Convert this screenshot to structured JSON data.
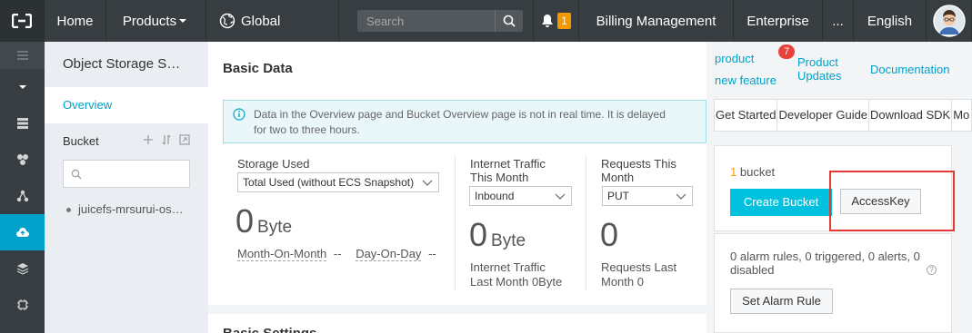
{
  "topbar": {
    "home": "Home",
    "products": "Products",
    "global": "Global",
    "search_placeholder": "Search",
    "notification_count": "1",
    "billing": "Billing Management",
    "enterprise": "Enterprise",
    "more": "...",
    "language": "English"
  },
  "sidebar": {
    "title": "Object Storage S…",
    "overview": "Overview",
    "bucket_heading": "Bucket",
    "bucket_item": "juicefs-mrsurui-os…"
  },
  "basic_data": {
    "title": "Basic Data",
    "notice_line1": "Data in the Overview page and Bucket Overview page is not in real time. It is delayed",
    "notice_line2": "for two to three hours.",
    "storage": {
      "label": "Storage Used",
      "select_value": "Total Used (without ECS Snapshot)",
      "value": "0",
      "unit": "Byte",
      "mom_label": "Month-On-Month",
      "mom_value": "--",
      "dod_label": "Day-On-Day",
      "dod_value": "--"
    },
    "traffic": {
      "label_line1": "Internet Traffic",
      "label_line2": "This Month",
      "select_value": "Inbound",
      "value": "0",
      "unit": "Byte",
      "last_line1": "Internet Traffic",
      "last_line2": "Last Month",
      "last_value": "0Byte"
    },
    "requests": {
      "label_line1": "Requests This",
      "label_line2": "Month",
      "select_value": "PUT",
      "value": "0",
      "last_line1": "Requests Last",
      "last_line2": "Month",
      "last_value": "0"
    }
  },
  "basic_settings": {
    "title": "Basic Settings"
  },
  "right": {
    "product_line1": "product",
    "product_line2": "new feature",
    "updates_badge": "7",
    "updates_line1": "Product",
    "updates_line2": "Updates",
    "documentation": "Documentation",
    "tabs": [
      "Get Started",
      "Developer Guide",
      "Download SDK",
      "Mo"
    ],
    "bucket_count": "1",
    "bucket_count_label": "bucket",
    "create_bucket": "Create Bucket",
    "accesskey": "AccessKey",
    "alarm_text": "0 alarm rules, 0 triggered, 0 alerts, 0 disabled",
    "set_alarm_rule": "Set Alarm Rule"
  },
  "colors": {
    "topbar": "#373d41",
    "accent": "#00a2ca",
    "primary_button": "#00c1de",
    "highlight": "#e53935",
    "badge": "#f39800"
  }
}
